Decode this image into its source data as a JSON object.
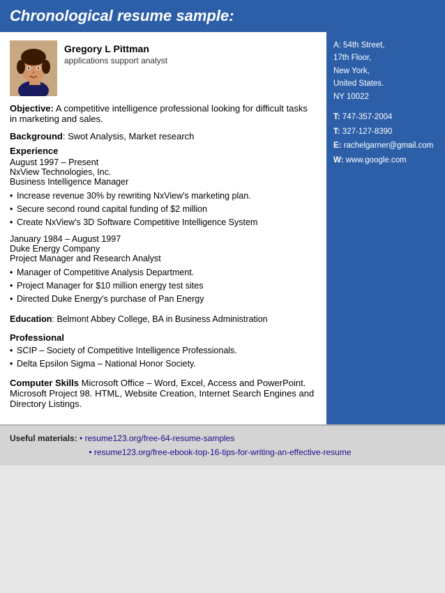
{
  "header": {
    "title": "Chronological resume sample:"
  },
  "profile": {
    "name": "Gregory L Pittman",
    "job_title": "applications support analyst",
    "avatar_label": "person photo"
  },
  "objective": {
    "label": "Objective:",
    "text": "A competitive intelligence professional looking for difficult tasks in marketing and sales."
  },
  "background": {
    "label": "Background",
    "text": ": Swot Analysis, Market research"
  },
  "experience": {
    "label": "Experience",
    "jobs": [
      {
        "dates": "August 1997 – Present",
        "company": "NxView Technologies, Inc.",
        "role": "Business Intelligence Manager",
        "bullets": [
          "Increase revenue 30% by rewriting NxView's marketing plan.",
          "Secure second round capital funding of $2 million",
          "Create NxView's 3D Software Competitive Intelligence System"
        ]
      },
      {
        "dates": "January 1984 – August 1997",
        "company": "Duke Energy Company",
        "role": "Project Manager and Research Analyst",
        "bullets": [
          "Manager of Competitive Analysis Department.",
          "Project Manager for $10 million energy test sites",
          "Directed Duke Energy's purchase of Pan Energy"
        ]
      }
    ]
  },
  "education": {
    "label": "Education",
    "text": ": Belmont Abbey College, BA in Business Administration"
  },
  "professional": {
    "label": "Professional",
    "bullets": [
      "SCIP – Society of Competitive Intelligence Professionals.",
      "Delta Epsilon Sigma – National Honor Society."
    ]
  },
  "computer_skills": {
    "label": "Computer Skills",
    "text": "Microsoft Office – Word, Excel, Access and PowerPoint. Microsoft Project 98. HTML, Website Creation, Internet Search Engines and Directory Listings."
  },
  "sidebar": {
    "address": {
      "line1": "A: 54th Street,",
      "line2": "17th Floor,",
      "line3": "New York,",
      "line4": "United States.",
      "line5": "NY 10022"
    },
    "contacts": [
      {
        "label": "T:",
        "value": "747-357-2004"
      },
      {
        "label": "T:",
        "value": "327-127-8390"
      },
      {
        "label": "E:",
        "value": "rachelgarner@gmail.com"
      },
      {
        "label": "W:",
        "value": "www.google.com"
      }
    ]
  },
  "footer": {
    "label": "Useful materials:",
    "links": [
      "resume123.org/free-64-resume-samples",
      "resume123.org/free-ebook-top-16-tips-for-writing-an-effective-resume"
    ]
  }
}
